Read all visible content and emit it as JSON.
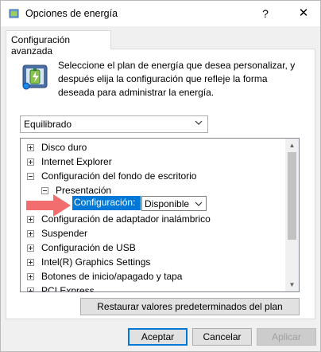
{
  "window": {
    "title": "Opciones de energía",
    "help_label": "?",
    "close_label": "✕"
  },
  "tab": {
    "label": "Configuración avanzada"
  },
  "description": "Seleccione el plan de energía que desea personalizar, y después elija la configuración que refleje la forma deseada para administrar la energía.",
  "plan_select": {
    "value": "Equilibrado"
  },
  "tree": {
    "items": [
      {
        "label": "Disco duro"
      },
      {
        "label": "Internet Explorer"
      },
      {
        "label": "Configuración del fondo de escritorio"
      },
      {
        "label": "Presentación"
      },
      {
        "label": "Configuración:"
      },
      {
        "label": "Configuración de adaptador inalámbrico"
      },
      {
        "label": "Suspender"
      },
      {
        "label": "Configuración de USB"
      },
      {
        "label": "Intel(R) Graphics Settings"
      },
      {
        "label": "Botones de inicio/apagado y tapa"
      },
      {
        "label": "PCI Express"
      }
    ],
    "setting_value": "Disponible"
  },
  "restore_button": "Restaurar valores predeterminados del plan",
  "buttons": {
    "accept": "Aceptar",
    "cancel": "Cancelar",
    "apply": "Aplicar"
  },
  "colors": {
    "accent": "#0078d7",
    "arrow": "#f26d6d"
  }
}
